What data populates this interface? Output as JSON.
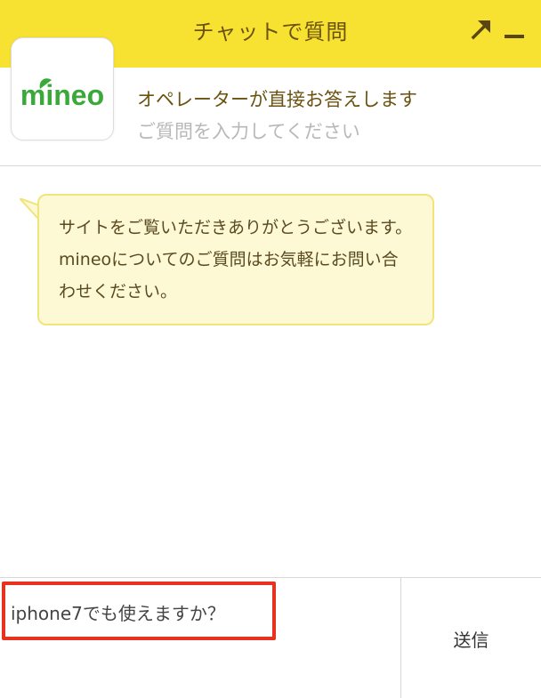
{
  "header": {
    "title": "チャットで質問",
    "expand_icon": "expand-arrow-icon",
    "minimize_icon": "minimize-icon",
    "background_color": "#f8e231"
  },
  "info": {
    "logo_text": "mineo",
    "logo_color": "#3aa93a",
    "operator_text": "オペレーターが直接お答えします",
    "prompt_text": "ご質問を入力してください"
  },
  "messages": [
    {
      "sender": "operator",
      "text": "サイトをご覧いただきありがとうございます。mineoについてのご質問はお気軽にお問い合わせください。"
    }
  ],
  "input": {
    "value": "iphone7でも使えますか？",
    "placeholder": ""
  },
  "send_button": {
    "label": "送信"
  },
  "accent_colors": {
    "highlight_border": "#e8321e",
    "bubble_background": "#fdf9d5",
    "bubble_border": "#f1e47a"
  }
}
